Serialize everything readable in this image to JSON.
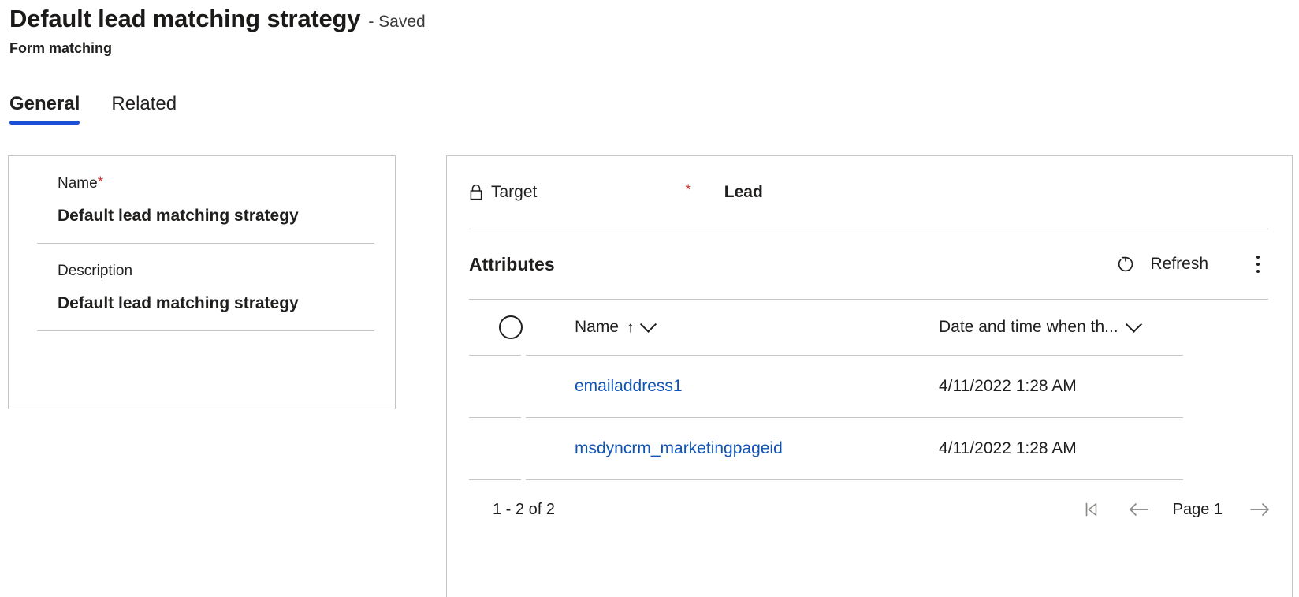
{
  "header": {
    "title": "Default lead matching strategy",
    "saved_state": "- Saved",
    "subtitle": "Form matching"
  },
  "tabs": [
    {
      "label": "General",
      "active": true
    },
    {
      "label": "Related",
      "active": false
    }
  ],
  "left_card": {
    "name": {
      "label": "Name",
      "required_marker": "*",
      "value": "Default lead matching strategy"
    },
    "description": {
      "label": "Description",
      "value": "Default lead matching strategy"
    }
  },
  "right_panel": {
    "target": {
      "icon": "lock-icon",
      "label": "Target",
      "required_marker": "*",
      "value": "Lead"
    },
    "attributes_toolbar": {
      "title": "Attributes",
      "refresh_icon": "refresh-icon",
      "refresh_label": "Refresh",
      "overflow_icon": "more-vertical-icon"
    },
    "grid": {
      "select_all_icon": "select-all-circle-icon",
      "columns": [
        {
          "label": "Name",
          "sort_icon": "sort-ascending-arrow",
          "menu_icon": "chevron-down-icon"
        },
        {
          "label": "Date and time when th...",
          "menu_icon": "chevron-down-icon"
        }
      ],
      "rows": [
        {
          "name": "emailaddress1",
          "date": "4/11/2022 1:28 AM"
        },
        {
          "name": "msdyncrm_marketingpageid",
          "date": "4/11/2022 1:28 AM"
        }
      ],
      "footer": {
        "record_count": "1 - 2 of 2",
        "first_page_icon": "first-page-icon",
        "previous_page_icon": "previous-page-arrow-icon",
        "page_label": "Page 1",
        "next_page_icon": "next-page-arrow-icon"
      }
    }
  },
  "colors": {
    "accent": "#1b4fd8",
    "link": "#0f53b5",
    "required": "#d13438",
    "border": "#c8c6c4",
    "disabled": "#8a8886"
  }
}
